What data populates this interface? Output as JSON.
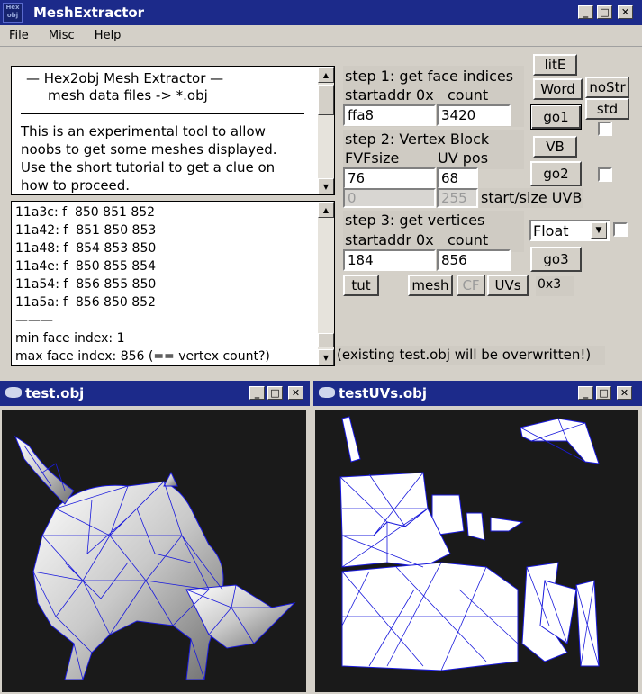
{
  "window": {
    "app_icon_text": "Hex obj",
    "title": "MeshExtractor"
  },
  "menu": [
    "File",
    "Misc",
    "Help"
  ],
  "info": {
    "line1": "—   Hex2obj Mesh Extractor   —",
    "line2": "mesh data files -> *.obj",
    "body": [
      "This is an experimental tool to allow",
      "noobs to get some meshes displayed.",
      "Use the short tutorial to get a clue on",
      "how to proceed."
    ]
  },
  "log": {
    "lines": [
      "11a3c: f  850 851 852",
      "11a42: f  851 850 853",
      "11a48: f  854 853 850",
      "11a4e: f  850 855 854",
      "11a54: f  856 855 850",
      "11a5a: f  856 850 852"
    ],
    "separator": "———",
    "min": "min face index: 1",
    "max": "max face index: 856 (== vertex count?)"
  },
  "step1": {
    "title": "step 1: get face indices",
    "start_label": "startaddr 0x",
    "count_label": "count",
    "start_value": "ffa8",
    "count_value": "3420"
  },
  "step2": {
    "title": "step 2: Vertex Block",
    "fvf_label": "FVFsize",
    "uv_label": "UV pos",
    "fvf_value": "76",
    "uv_value": "68",
    "uvb_start": "0",
    "uvb_size": "255",
    "uvb_label": "start/size UVB"
  },
  "step3": {
    "title": "step 3: get vertices",
    "start_label": "startaddr 0x",
    "count_label": "count",
    "start_value": "184",
    "count_value": "856",
    "format": "Float"
  },
  "buttons": {
    "lite": "litE",
    "word": "Word",
    "nostr": "noStr",
    "go1": "go1",
    "std": "std",
    "vb": "VB",
    "go2": "go2",
    "go3": "go3",
    "tut": "tut",
    "mesh": "mesh",
    "cf": "CF",
    "uvs": "UVs",
    "hex_readout": "0x3"
  },
  "status": "(existing test.obj will be overwritten!)",
  "viewer1": {
    "title": "test.obj"
  },
  "viewer2": {
    "title": "testUVs.obj"
  },
  "colors": {
    "titlebar": "#1c2a8a",
    "mesh_wire": "#1a1adc",
    "viewport_bg": "#1a1a1a"
  }
}
